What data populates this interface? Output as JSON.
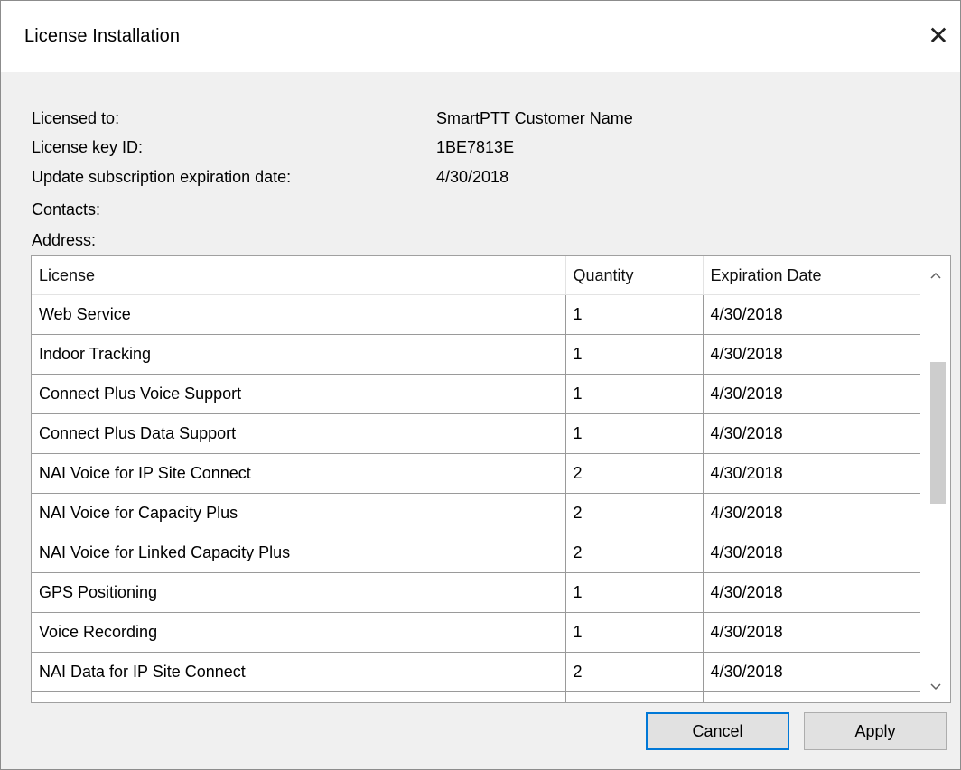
{
  "window": {
    "title": "License Installation",
    "close_glyph": "✕"
  },
  "info": {
    "licensed_to_label": "Licensed to:",
    "licensed_to_value": "SmartPTT Customer Name",
    "key_id_label": "License key ID:",
    "key_id_value": "1BE7813E",
    "expiration_label": "Update subscription expiration date:",
    "expiration_value": "4/30/2018",
    "contacts_label": "Contacts:",
    "address_label": "Address:"
  },
  "table": {
    "columns": [
      "License",
      "Quantity",
      "Expiration Date"
    ],
    "rows": [
      {
        "license": "Web Service",
        "quantity": "1",
        "expiration": "4/30/2018"
      },
      {
        "license": "Indoor Tracking",
        "quantity": "1",
        "expiration": "4/30/2018"
      },
      {
        "license": "Connect Plus Voice Support",
        "quantity": "1",
        "expiration": "4/30/2018"
      },
      {
        "license": "Connect Plus Data Support",
        "quantity": "1",
        "expiration": "4/30/2018"
      },
      {
        "license": "NAI Voice for IP Site Connect",
        "quantity": "2",
        "expiration": "4/30/2018"
      },
      {
        "license": "NAI Voice for Capacity Plus",
        "quantity": "2",
        "expiration": "4/30/2018"
      },
      {
        "license": "NAI Voice for Linked Capacity Plus",
        "quantity": "2",
        "expiration": "4/30/2018"
      },
      {
        "license": "GPS Positioning",
        "quantity": "1",
        "expiration": "4/30/2018"
      },
      {
        "license": "Voice Recording",
        "quantity": "1",
        "expiration": "4/30/2018"
      },
      {
        "license": "NAI Data for IP Site Connect",
        "quantity": "2",
        "expiration": "4/30/2018"
      },
      {
        "license": "",
        "quantity": "",
        "expiration": ""
      }
    ],
    "scroll_up_glyph": "^",
    "scroll_down_glyph": "v"
  },
  "buttons": {
    "cancel": "Cancel",
    "apply": "Apply"
  },
  "colors": {
    "focus_border": "#0078d7",
    "button_face": "#e1e1e1",
    "dialog_background": "#f0f0f0"
  },
  "icons": [
    "close-icon",
    "scroll-up-icon",
    "scroll-down-icon"
  ]
}
